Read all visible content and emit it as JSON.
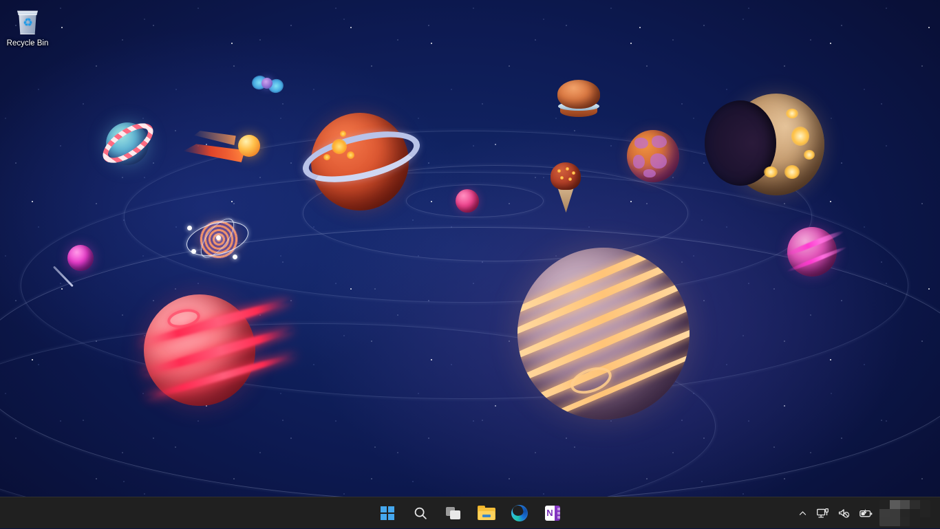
{
  "desktop": {
    "wallpaper_name": "space-planets-wallpaper",
    "background_colors": {
      "deep": "#060b28",
      "mid": "#0d1a52",
      "highlight": "#132a6e"
    },
    "icons": [
      {
        "name": "recycle-bin",
        "label": "Recycle Bin",
        "glyph": "recycle-bin-icon"
      }
    ],
    "celestial_objects": [
      {
        "name": "red-ringed-planet",
        "label": "Red ringed planet"
      },
      {
        "name": "jupiter-planet",
        "label": "Large banded planet"
      },
      {
        "name": "pink-swirl-planet",
        "label": "Pink swirl planet"
      },
      {
        "name": "crescent-moon-planet",
        "label": "Crescent moon planet"
      },
      {
        "name": "magenta-cracked-planet",
        "label": "Magenta cracked planet"
      },
      {
        "name": "pink-planet-right",
        "label": "Pink planet"
      },
      {
        "name": "small-pink-planet",
        "label": "Small pink planet"
      },
      {
        "name": "burger-planet",
        "label": "Burger planet"
      },
      {
        "name": "icecream-cone",
        "label": "Ice cream cone"
      },
      {
        "name": "candy-cane-planet",
        "label": "Candy cane ringed planet"
      },
      {
        "name": "comet",
        "label": "Comet"
      },
      {
        "name": "spiral-planet",
        "label": "Spiral planet with orbital rings"
      },
      {
        "name": "lollipop",
        "label": "Lollipop"
      },
      {
        "name": "blue-bowtie",
        "label": "Blue bowtie object"
      }
    ]
  },
  "taskbar": {
    "background_color": "#202020",
    "buttons": [
      {
        "name": "start-button",
        "label": "Start",
        "icon": "windows-logo-icon"
      },
      {
        "name": "search-button",
        "label": "Search",
        "icon": "search-icon"
      },
      {
        "name": "task-view-button",
        "label": "Task View",
        "icon": "task-view-icon"
      },
      {
        "name": "file-explorer-button",
        "label": "File Explorer",
        "icon": "folder-icon"
      },
      {
        "name": "edge-button",
        "label": "Microsoft Edge",
        "icon": "edge-icon"
      },
      {
        "name": "onenote-button",
        "label": "OneNote",
        "icon": "onenote-icon",
        "letter": "N"
      }
    ],
    "tray": {
      "items": [
        {
          "name": "show-hidden-icons",
          "label": "Show hidden icons",
          "icon": "chevron-up-icon"
        },
        {
          "name": "network-icon",
          "label": "Network",
          "icon": "network-monitor-icon"
        },
        {
          "name": "volume-icon",
          "label": "Volume muted",
          "icon": "speaker-muted-icon"
        },
        {
          "name": "battery-icon",
          "label": "Battery charging",
          "icon": "battery-charging-icon"
        }
      ],
      "clock": {
        "name": "clock-redacted",
        "state": "redacted",
        "text": ""
      }
    }
  }
}
